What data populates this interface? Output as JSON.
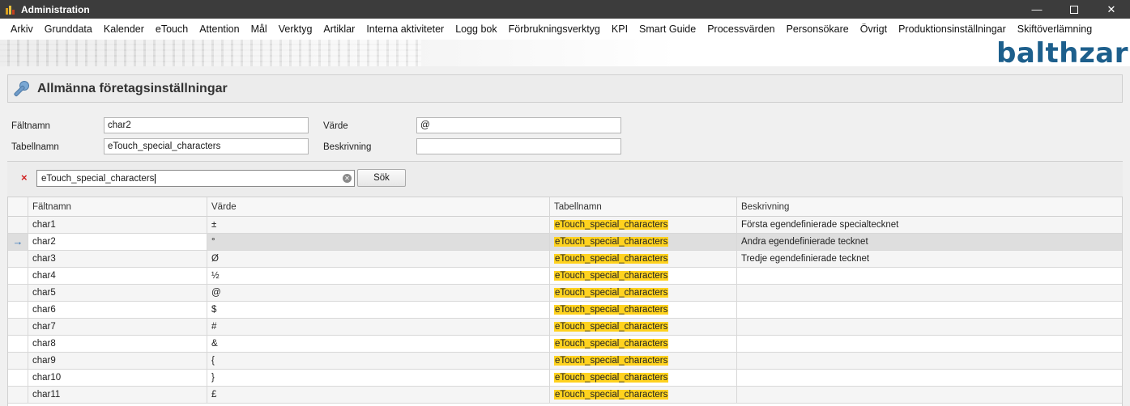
{
  "window": {
    "title": "Administration",
    "minimize_glyph": "—",
    "close_glyph": "✕"
  },
  "menu": [
    "Arkiv",
    "Grunddata",
    "Kalender",
    "eTouch",
    "Attention",
    "Mål",
    "Verktyg",
    "Artiklar",
    "Interna aktiviteter",
    "Logg bok",
    "Förbrukningsverktyg",
    "KPI",
    "Smart Guide",
    "Processvärden",
    "Personsökare",
    "Övrigt",
    "Produktionsinställningar",
    "Skiftöverlämning"
  ],
  "brand": {
    "logo_text": "balthzar",
    "color": "#1d5f8c"
  },
  "panel": {
    "title": "Allmänna företagsinställningar"
  },
  "form": {
    "faltnamn_label": "Fältnamn",
    "faltnamn_value": "char2",
    "tabellnamn_label": "Tabellnamn",
    "tabellnamn_value": "eTouch_special_characters",
    "varde_label": "Värde",
    "varde_value": "@",
    "beskrivning_label": "Beskrivning",
    "beskrivning_value": ""
  },
  "search": {
    "value": "eTouch_special_characters",
    "button_label": "Sök",
    "clear_glyph": "×"
  },
  "grid": {
    "columns": [
      "Fältnamn",
      "Värde",
      "Tabellnamn",
      "Beskrivning"
    ],
    "current_row_indicator": "→",
    "highlight_color": "#ffd21f",
    "rows": [
      {
        "faltnamn": "char1",
        "varde": "±",
        "tabellnamn": "eTouch_special_characters",
        "beskrivning": "Första egendefinierade specialtecknet"
      },
      {
        "faltnamn": "char2",
        "varde": "°",
        "tabellnamn": "eTouch_special_characters",
        "beskrivning": "Andra egendefinierade tecknet",
        "selected": true
      },
      {
        "faltnamn": "char3",
        "varde": "Ø",
        "tabellnamn": "eTouch_special_characters",
        "beskrivning": "Tredje egendefinierade tecknet"
      },
      {
        "faltnamn": "char4",
        "varde": "½",
        "tabellnamn": "eTouch_special_characters",
        "beskrivning": ""
      },
      {
        "faltnamn": "char5",
        "varde": "@",
        "tabellnamn": "eTouch_special_characters",
        "beskrivning": ""
      },
      {
        "faltnamn": "char6",
        "varde": "$",
        "tabellnamn": "eTouch_special_characters",
        "beskrivning": ""
      },
      {
        "faltnamn": "char7",
        "varde": "#",
        "tabellnamn": "eTouch_special_characters",
        "beskrivning": ""
      },
      {
        "faltnamn": "char8",
        "varde": "&",
        "tabellnamn": "eTouch_special_characters",
        "beskrivning": ""
      },
      {
        "faltnamn": "char9",
        "varde": "{",
        "tabellnamn": "eTouch_special_characters",
        "beskrivning": ""
      },
      {
        "faltnamn": "char10",
        "varde": "}",
        "tabellnamn": "eTouch_special_characters",
        "beskrivning": ""
      },
      {
        "faltnamn": "char11",
        "varde": "£",
        "tabellnamn": "eTouch_special_characters",
        "beskrivning": ""
      }
    ]
  }
}
